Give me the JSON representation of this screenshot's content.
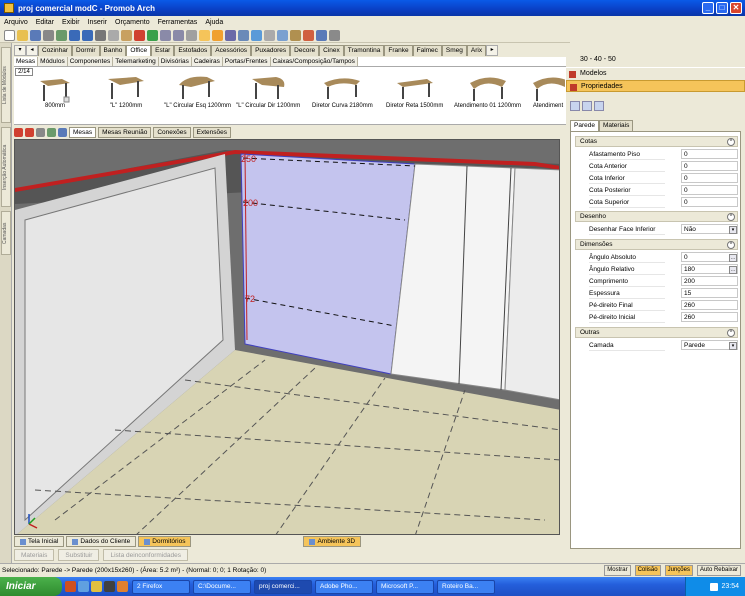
{
  "window": {
    "title": "proj comercial modC - Promob Arch"
  },
  "menu": [
    "Arquivo",
    "Editar",
    "Exibir",
    "Inserir",
    "Orçamento",
    "Ferramentas",
    "Ajuda"
  ],
  "category_tabs": [
    "Cozinhar",
    "Dormir",
    "Banho",
    "Office",
    "Estar",
    "Estofados",
    "Acessórios",
    "Puxadores",
    "Decore",
    "Cinex",
    "Tramontina",
    "Franke",
    "Falmec",
    "Smeg",
    "Arix"
  ],
  "category_active": "Office",
  "sub_tabs": [
    "Mesas",
    "Módulos",
    "Componentes",
    "Telemarketing",
    "Divisórias",
    "Cadeiras",
    "Portas/Frentes",
    "Caixas/Composição/Tampos"
  ],
  "pager": "2/14",
  "catalog_items": [
    "800mm",
    "\"L\" 1200mm",
    "\"L\" Circular Esq 1200mm",
    "\"L\" Circular Dir 1200mm",
    "Diretor Curva 2180mm",
    "Diretor Reta 1500mm",
    "Atendimento 01 1200mm",
    "Atendiment"
  ],
  "bottom_tabs": [
    "Mesas",
    "Mesas Reunião",
    "Conexões",
    "Extensões"
  ],
  "viewport": {
    "dimension_labels": [
      "250",
      "200",
      "72"
    ]
  },
  "view_tabs": [
    "Tela Inicial",
    "Dados do Cliente",
    "Dormitórios",
    "Ambiente 3D"
  ],
  "action_buttons": [
    "Materiais",
    "Substituir",
    "Lista deinconformidades"
  ],
  "status": {
    "text": "Selecionado: Parede -> Parede (200x15x260) - (Área: 5.2 m²) - (Normal: 0; 0; 1 Rotação: 0)",
    "mostrar": "Mostrar",
    "colisao": "Colisão",
    "juncoes": "Junções",
    "auto_rebaixar": "Auto Rebaixar"
  },
  "right_panel": {
    "size_label": "30 - 40 - 50",
    "modelos": "Modelos",
    "propriedades": "Propriedades",
    "tabs": [
      "Parede",
      "Materiais"
    ],
    "groups": {
      "cotas": "Cotas",
      "desenho": "Desenho",
      "dimensoes": "Dimensões",
      "outras": "Outras"
    },
    "cotas_rows": [
      {
        "label": "Afastamento Piso",
        "value": "0"
      },
      {
        "label": "Cota Anterior",
        "value": "0"
      },
      {
        "label": "Cota Inferior",
        "value": "0"
      },
      {
        "label": "Cota Posterior",
        "value": "0"
      },
      {
        "label": "Cota Superior",
        "value": "0"
      }
    ],
    "desenho_rows": [
      {
        "label": "Desenhar Face Inferior",
        "value": "Não"
      }
    ],
    "dimensoes_rows": [
      {
        "label": "Ângulo Absoluto",
        "value": "0"
      },
      {
        "label": "Ângulo Relativo",
        "value": "180"
      },
      {
        "label": "Comprimento",
        "value": "200"
      },
      {
        "label": "Espessura",
        "value": "15"
      },
      {
        "label": "Pé-direito Final",
        "value": "260"
      },
      {
        "label": "Pé-direito Inicial",
        "value": "260"
      }
    ],
    "outras_rows": [
      {
        "label": "Camada",
        "value": "Parede"
      }
    ]
  },
  "left_strip_tabs": [
    "Lista de Módulos",
    "Inserção Automática",
    "Camadas"
  ],
  "taskbar": {
    "start": "Iniciar",
    "tasks": [
      "2 Firefox",
      "C:\\Docume...",
      "proj comerci...",
      "Adobe Pho...",
      "Microsoft P...",
      "Roteiro Ba..."
    ],
    "clock": "23:54"
  }
}
